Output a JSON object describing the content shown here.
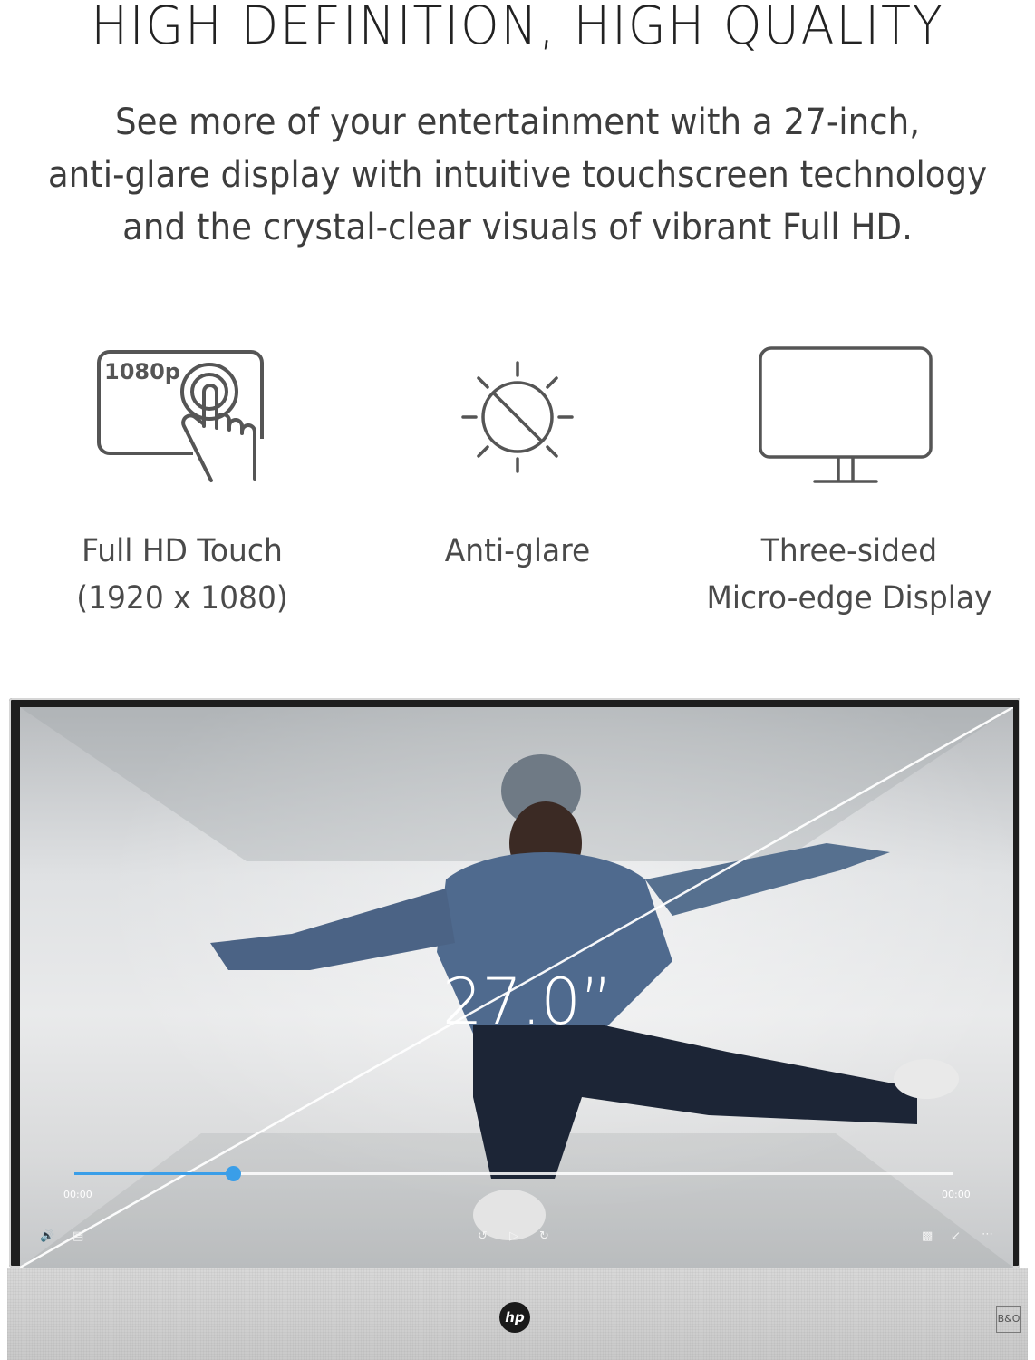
{
  "headline": "HIGH DEFINITION, HIGH QUALITY",
  "subcopy": [
    "See more of your entertainment with a 27-inch,",
    "anti-glare display with intuitive touchscreen technology",
    "and the crystal-clear visuals of vibrant Full HD."
  ],
  "features": [
    {
      "icon": "touch-1080p-icon",
      "badge": "1080p",
      "label_lines": [
        "Full HD Touch",
        "(1920 x 1080)"
      ]
    },
    {
      "icon": "anti-glare-icon",
      "label_lines": [
        "Anti-glare"
      ]
    },
    {
      "icon": "monitor-icon",
      "label_lines": [
        "Three-sided",
        "Micro-edge Display"
      ]
    }
  ],
  "monitor": {
    "diagonal_label": "27.0”",
    "player": {
      "progress": 0.18,
      "time_start": "00:00",
      "time_end": "00:00",
      "accent_color": "#3a9ee8"
    },
    "brand_logo": "hp",
    "audio_badge": "B&O"
  },
  "colors": {
    "icon_stroke": "#555555",
    "text": "#3d3d3d"
  }
}
